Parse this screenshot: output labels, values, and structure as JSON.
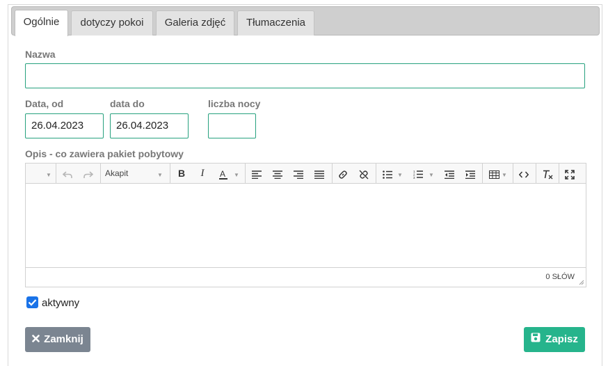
{
  "tabs": [
    {
      "label": "Ogólnie",
      "active": true
    },
    {
      "label": "dotyczy pokoi",
      "active": false
    },
    {
      "label": "Galeria zdjęć",
      "active": false
    },
    {
      "label": "Tłumaczenia",
      "active": false
    }
  ],
  "form": {
    "name_label": "Nazwa",
    "name_value": "",
    "date_from_label": "Data, od",
    "date_from_value": "26.04.2023",
    "date_to_label": "data do",
    "date_to_value": "26.04.2023",
    "nights_label": "liczba nocy",
    "nights_value": "",
    "description_label": "Opis - co zawiera pakiet pobytowy",
    "active_label": "aktywny",
    "active_checked": true
  },
  "editor": {
    "format_select": "Akapit",
    "word_count": "0 SŁÓW",
    "content": ""
  },
  "buttons": {
    "close_label": "Zamknij",
    "save_label": "Zapisz"
  },
  "colors": {
    "accent": "#26a17e",
    "save_button": "#26b48c",
    "close_button": "#7b8591",
    "checkbox": "#1a73e8"
  }
}
